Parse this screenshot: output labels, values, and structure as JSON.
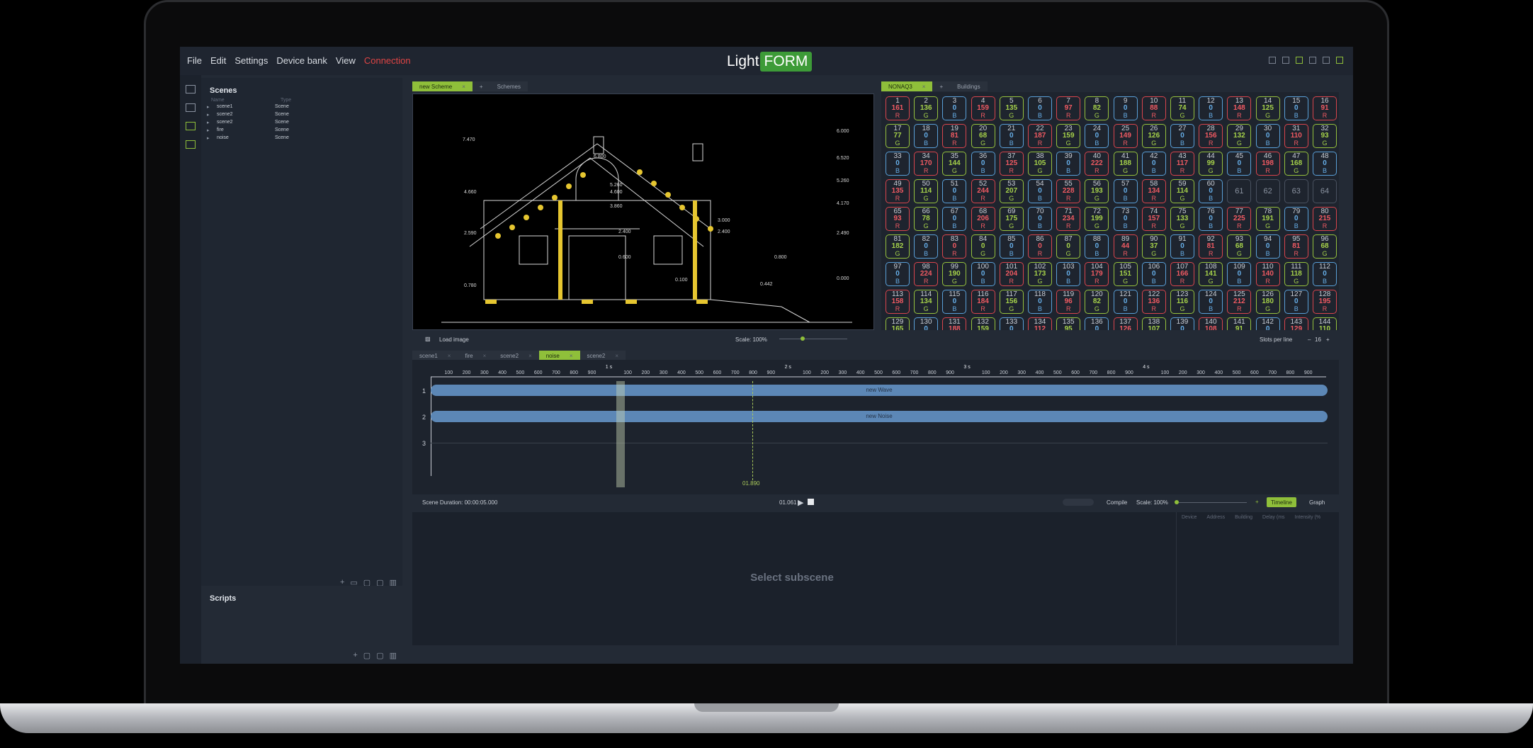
{
  "menu": {
    "items": [
      "File",
      "Edit",
      "Settings",
      "Device bank",
      "View"
    ],
    "connection": "Connection"
  },
  "logo": {
    "light": "Light",
    "form": "FORM"
  },
  "scenes_panel": {
    "title": "Scenes",
    "columns": [
      "Name",
      "Type"
    ],
    "rows": [
      {
        "name": "scene1",
        "type": "Scene"
      },
      {
        "name": "scene2",
        "type": "Scene"
      },
      {
        "name": "scene2",
        "type": "Scene"
      },
      {
        "name": "fire",
        "type": "Scene"
      },
      {
        "name": "noise",
        "type": "Scene"
      }
    ]
  },
  "scripts_panel": {
    "title": "Scripts"
  },
  "scheme": {
    "tabs": [
      "new Scheme",
      "Schemes"
    ],
    "load_image": "Load image",
    "scale": "Scale: 100%",
    "dimensions": [
      "7.470",
      "6.000",
      "4.660",
      "5.260",
      "4.600",
      "3.860",
      "6.520",
      "5.260",
      "3.000",
      "2.400",
      "2.590",
      "2.400",
      "2.490",
      "4.170",
      "0.600",
      "0.100",
      "0.800",
      "0.780",
      "0.442",
      "0.000",
      "6.800"
    ]
  },
  "devices": {
    "tabs": [
      "NONAQ3",
      "Buildings"
    ],
    "slots_label": "Slots per line",
    "slots_value": "16",
    "cells": [
      [
        1,
        161,
        "R"
      ],
      [
        2,
        136,
        "G"
      ],
      [
        3,
        0,
        "B"
      ],
      [
        4,
        159,
        "R"
      ],
      [
        5,
        135,
        "G"
      ],
      [
        6,
        0,
        "B"
      ],
      [
        7,
        97,
        "R"
      ],
      [
        8,
        82,
        "G"
      ],
      [
        9,
        0,
        "B"
      ],
      [
        10,
        88,
        "R"
      ],
      [
        11,
        74,
        "G"
      ],
      [
        12,
        0,
        "B"
      ],
      [
        13,
        148,
        "R"
      ],
      [
        14,
        125,
        "G"
      ],
      [
        15,
        0,
        "B"
      ],
      [
        16,
        91,
        "R"
      ],
      [
        17,
        77,
        "G"
      ],
      [
        18,
        0,
        "B"
      ],
      [
        19,
        81,
        "R"
      ],
      [
        20,
        68,
        "G"
      ],
      [
        21,
        0,
        "B"
      ],
      [
        22,
        187,
        "R"
      ],
      [
        23,
        159,
        "G"
      ],
      [
        24,
        0,
        "B"
      ],
      [
        25,
        149,
        "R"
      ],
      [
        26,
        126,
        "G"
      ],
      [
        27,
        0,
        "B"
      ],
      [
        28,
        156,
        "R"
      ],
      [
        29,
        132,
        "G"
      ],
      [
        30,
        0,
        "B"
      ],
      [
        31,
        110,
        "R"
      ],
      [
        32,
        93,
        "G"
      ],
      [
        33,
        0,
        "B"
      ],
      [
        34,
        170,
        "R"
      ],
      [
        35,
        144,
        "G"
      ],
      [
        36,
        0,
        "B"
      ],
      [
        37,
        125,
        "R"
      ],
      [
        38,
        105,
        "G"
      ],
      [
        39,
        0,
        "B"
      ],
      [
        40,
        222,
        "R"
      ],
      [
        41,
        188,
        "G"
      ],
      [
        42,
        0,
        "B"
      ],
      [
        43,
        117,
        "R"
      ],
      [
        44,
        99,
        "G"
      ],
      [
        45,
        0,
        "B"
      ],
      [
        46,
        198,
        "R"
      ],
      [
        47,
        168,
        "G"
      ],
      [
        48,
        0,
        "B"
      ],
      [
        49,
        135,
        "R"
      ],
      [
        50,
        114,
        "G"
      ],
      [
        51,
        0,
        "B"
      ],
      [
        52,
        244,
        "R"
      ],
      [
        53,
        207,
        "G"
      ],
      [
        54,
        0,
        "B"
      ],
      [
        55,
        228,
        "R"
      ],
      [
        56,
        193,
        "G"
      ],
      [
        57,
        0,
        "B"
      ],
      [
        58,
        134,
        "R"
      ],
      [
        59,
        114,
        "G"
      ],
      [
        60,
        0,
        "B"
      ],
      [
        61,
        null,
        "E"
      ],
      [
        62,
        null,
        "E"
      ],
      [
        63,
        null,
        "E"
      ],
      [
        64,
        null,
        "E"
      ],
      [
        65,
        93,
        "R"
      ],
      [
        66,
        78,
        "G"
      ],
      [
        67,
        0,
        "B"
      ],
      [
        68,
        206,
        "R"
      ],
      [
        69,
        175,
        "G"
      ],
      [
        70,
        0,
        "B"
      ],
      [
        71,
        234,
        "R"
      ],
      [
        72,
        199,
        "G"
      ],
      [
        73,
        0,
        "B"
      ],
      [
        74,
        157,
        "R"
      ],
      [
        75,
        133,
        "G"
      ],
      [
        76,
        0,
        "B"
      ],
      [
        77,
        225,
        "R"
      ],
      [
        78,
        191,
        "G"
      ],
      [
        79,
        0,
        "B"
      ],
      [
        80,
        215,
        "R"
      ],
      [
        81,
        182,
        "G"
      ],
      [
        82,
        0,
        "B"
      ],
      [
        83,
        0,
        "R"
      ],
      [
        84,
        0,
        "G"
      ],
      [
        85,
        0,
        "B"
      ],
      [
        86,
        0,
        "R"
      ],
      [
        87,
        0,
        "G"
      ],
      [
        88,
        0,
        "B"
      ],
      [
        89,
        44,
        "R"
      ],
      [
        90,
        37,
        "G"
      ],
      [
        91,
        0,
        "B"
      ],
      [
        92,
        81,
        "R"
      ],
      [
        93,
        68,
        "G"
      ],
      [
        94,
        0,
        "B"
      ],
      [
        95,
        81,
        "R"
      ],
      [
        96,
        68,
        "G"
      ],
      [
        97,
        0,
        "B"
      ],
      [
        98,
        224,
        "R"
      ],
      [
        99,
        190,
        "G"
      ],
      [
        100,
        0,
        "B"
      ],
      [
        101,
        204,
        "R"
      ],
      [
        102,
        173,
        "G"
      ],
      [
        103,
        0,
        "B"
      ],
      [
        104,
        179,
        "R"
      ],
      [
        105,
        151,
        "G"
      ],
      [
        106,
        0,
        "B"
      ],
      [
        107,
        166,
        "R"
      ],
      [
        108,
        141,
        "G"
      ],
      [
        109,
        0,
        "B"
      ],
      [
        110,
        140,
        "R"
      ],
      [
        111,
        118,
        "G"
      ],
      [
        112,
        0,
        "B"
      ],
      [
        113,
        158,
        "R"
      ],
      [
        114,
        134,
        "G"
      ],
      [
        115,
        0,
        "B"
      ],
      [
        116,
        184,
        "R"
      ],
      [
        117,
        156,
        "G"
      ],
      [
        118,
        0,
        "B"
      ],
      [
        119,
        96,
        "R"
      ],
      [
        120,
        82,
        "G"
      ],
      [
        121,
        0,
        "B"
      ],
      [
        122,
        136,
        "R"
      ],
      [
        123,
        116,
        "G"
      ],
      [
        124,
        0,
        "B"
      ],
      [
        125,
        212,
        "R"
      ],
      [
        126,
        180,
        "G"
      ],
      [
        127,
        0,
        "B"
      ],
      [
        128,
        195,
        "R"
      ],
      [
        129,
        165,
        "G"
      ],
      [
        130,
        0,
        "B"
      ],
      [
        131,
        188,
        "R"
      ],
      [
        132,
        159,
        "G"
      ],
      [
        133,
        0,
        "B"
      ],
      [
        134,
        112,
        "R"
      ],
      [
        135,
        95,
        "G"
      ],
      [
        136,
        0,
        "B"
      ],
      [
        137,
        126,
        "R"
      ],
      [
        138,
        107,
        "G"
      ],
      [
        139,
        0,
        "B"
      ],
      [
        140,
        108,
        "R"
      ],
      [
        141,
        91,
        "G"
      ],
      [
        142,
        0,
        "B"
      ],
      [
        143,
        129,
        "R"
      ],
      [
        144,
        110,
        "G"
      ]
    ]
  },
  "timeline": {
    "tabs": [
      "scene1",
      "fire",
      "scene2",
      "noise",
      "scene2"
    ],
    "ruler_ticks": [
      "100",
      "200",
      "300",
      "400",
      "500",
      "600",
      "700",
      "800",
      "900"
    ],
    "ruler_seconds": [
      "1 s",
      "2 s",
      "3 s",
      "4 s"
    ],
    "cursor": "900",
    "tracks": [
      {
        "num": "1",
        "label": "new Wave"
      },
      {
        "num": "2",
        "label": "new Noise"
      },
      {
        "num": "3",
        "label": ""
      }
    ],
    "marker_time": "01.890",
    "duration": "Scene Duration: 00:00:05.000",
    "current_time": "01.061",
    "compile": "Compile",
    "scale": "Scale: 100%",
    "views": [
      "Timeline",
      "Graph"
    ]
  },
  "bottom": {
    "placeholder": "Select subscene",
    "columns": [
      "Device",
      "Address",
      "Building",
      "Delay (ms",
      "Intensity (%"
    ]
  }
}
